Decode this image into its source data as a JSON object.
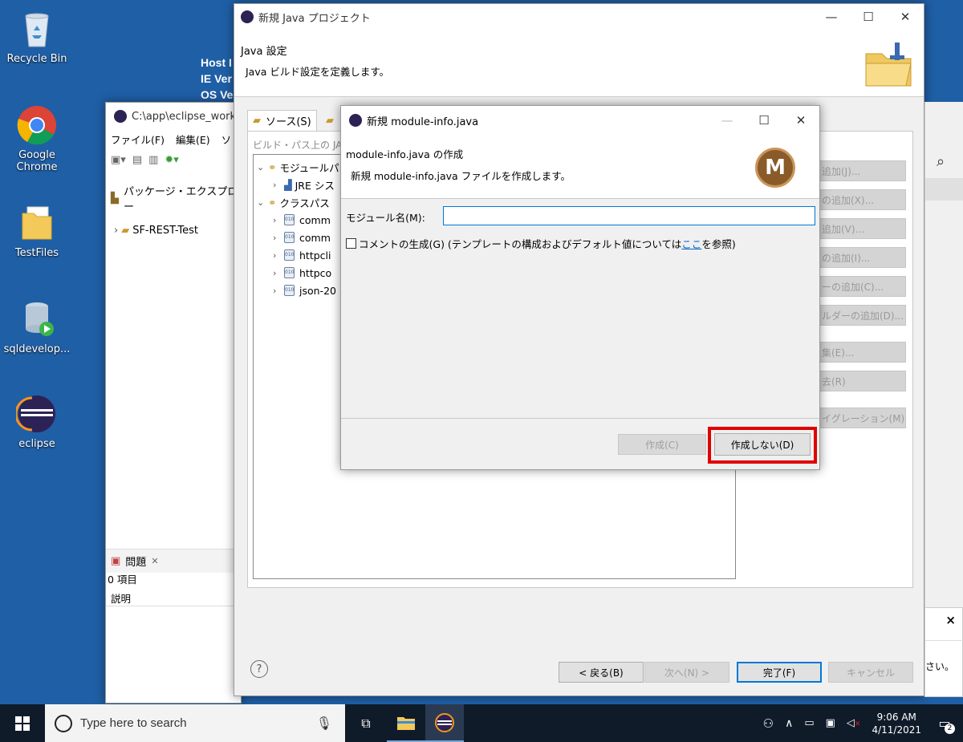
{
  "desktop": {
    "icons": [
      {
        "label": "Recycle Bin",
        "icon": "recycle-bin-icon"
      },
      {
        "label": "Google Chrome",
        "icon": "chrome-icon"
      },
      {
        "label": "TestFiles",
        "icon": "folder-icon"
      },
      {
        "label": "sqldevelop...",
        "icon": "sqldeveloper-icon"
      },
      {
        "label": "eclipse",
        "icon": "eclipse-icon"
      }
    ],
    "host_lines": [
      "Host I",
      "IE Ver",
      "OS Ve"
    ]
  },
  "eclipse": {
    "title": "C:\\app\\eclipse_work",
    "menu": [
      "ファイル(F)",
      "編集(E)",
      "ソ"
    ],
    "package_explorer": "パッケージ・エクスプロー",
    "project": "SF-REST-Test",
    "problems_tab": "問題",
    "problems_count": "0 項目",
    "problems_col": "説明"
  },
  "java_project_wizard": {
    "title": "新規 Java プロジェクト",
    "heading": "Java 設定",
    "description": "Java ビルド設定を定義します。",
    "tabs": [
      "ソース(S)"
    ],
    "build_path_label": "ビルド・パス上の JAR",
    "tree": [
      {
        "label": "モジュールパ",
        "level": 0,
        "expanded": true,
        "icon": "library-icon"
      },
      {
        "label": "JRE シス",
        "level": 1,
        "expanded": false,
        "icon": "jre-icon"
      },
      {
        "label": "クラスパス",
        "level": 0,
        "expanded": true,
        "icon": "library-icon"
      },
      {
        "label": "comm",
        "level": 1,
        "expanded": false,
        "icon": "jar-icon"
      },
      {
        "label": "comm",
        "level": 1,
        "expanded": false,
        "icon": "jar-icon"
      },
      {
        "label": "httpcli",
        "level": 1,
        "expanded": false,
        "icon": "jar-icon"
      },
      {
        "label": "httpco",
        "level": 1,
        "expanded": false,
        "icon": "jar-icon"
      },
      {
        "label": "json-20",
        "level": 1,
        "expanded": false,
        "icon": "jar-icon"
      }
    ],
    "side_buttons": [
      "追加(J)...",
      "の追加(X)...",
      "追加(V)...",
      "の追加(I)...",
      "ーの追加(C)...",
      "ルダーの追加(D)...",
      "集(E)...",
      "去(R)",
      "イグレーション(M)..."
    ],
    "footer": {
      "back": "< 戻る(B)",
      "next": "次へ(N) >",
      "finish": "完了(F)",
      "cancel": "キャンセル"
    }
  },
  "module_dialog": {
    "title": "新規 module-info.java",
    "heading": "module-info.java の作成",
    "description": "新規 module-info.java ファイルを作成します。",
    "logo_letter": "M",
    "module_name_label": "モジュール名(M):",
    "module_name_value": "",
    "comment_checkbox": "コメントの生成(G) (テンプレートの構成およびデフォルト値については",
    "comment_link": "ここ",
    "comment_suffix": "を参照)",
    "create_button": "作成(C)",
    "dont_create_button": "作成しない(D)"
  },
  "notification": {
    "close": "×",
    "text": "さい。"
  },
  "taskbar": {
    "search_placeholder": "Type here to search",
    "time": "9:06 AM",
    "date": "4/11/2021",
    "notif_count": "2"
  },
  "colors": {
    "highlight": "#e00000",
    "accent": "#0078d7",
    "desktop": "#1f5fa6",
    "link": "#0066cc"
  }
}
